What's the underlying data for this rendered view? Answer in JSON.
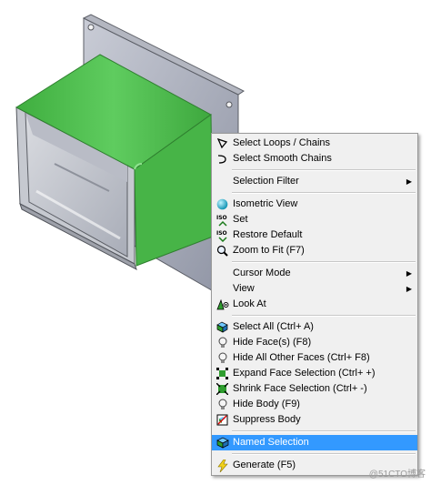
{
  "menu": {
    "select_loops_chains": "Select Loops / Chains",
    "select_smooth_chains": "Select Smooth Chains",
    "selection_filter": "Selection Filter",
    "isometric_view": "Isometric View",
    "set": "Set",
    "restore_default": "Restore Default",
    "zoom_to_fit": "Zoom to Fit (F7)",
    "cursor_mode": "Cursor Mode",
    "view": "View",
    "look_at": "Look At",
    "select_all": "Select All (Ctrl+ A)",
    "hide_faces": "Hide Face(s) (F8)",
    "hide_all_other_faces": "Hide All Other Faces (Ctrl+ F8)",
    "expand_face_selection": "Expand Face Selection (Ctrl+ +)",
    "shrink_face_selection": "Shrink Face Selection (Ctrl+ -)",
    "hide_body": "Hide Body (F9)",
    "suppress_body": "Suppress Body",
    "named_selection": "Named Selection",
    "generate": "Generate (F5)"
  },
  "icons": {
    "loops": "loop-select-icon",
    "smooth": "smooth-chain-icon",
    "isometric": "isometric-sphere-icon",
    "set": "iso-set-icon",
    "restore": "iso-restore-icon",
    "zoom": "zoom-fit-icon",
    "look_at": "look-at-icon",
    "select_all": "select-all-icon",
    "bulb": "lightbulb-icon",
    "expand": "expand-selection-icon",
    "shrink": "shrink-selection-icon",
    "suppress": "suppress-icon",
    "named": "named-selection-icon",
    "generate": "lightning-icon"
  },
  "watermark": "@51CTO博客",
  "colors": {
    "face_green": "#4cb84c",
    "highlight": "#3399ff",
    "menu_bg": "#f0f0f0"
  }
}
